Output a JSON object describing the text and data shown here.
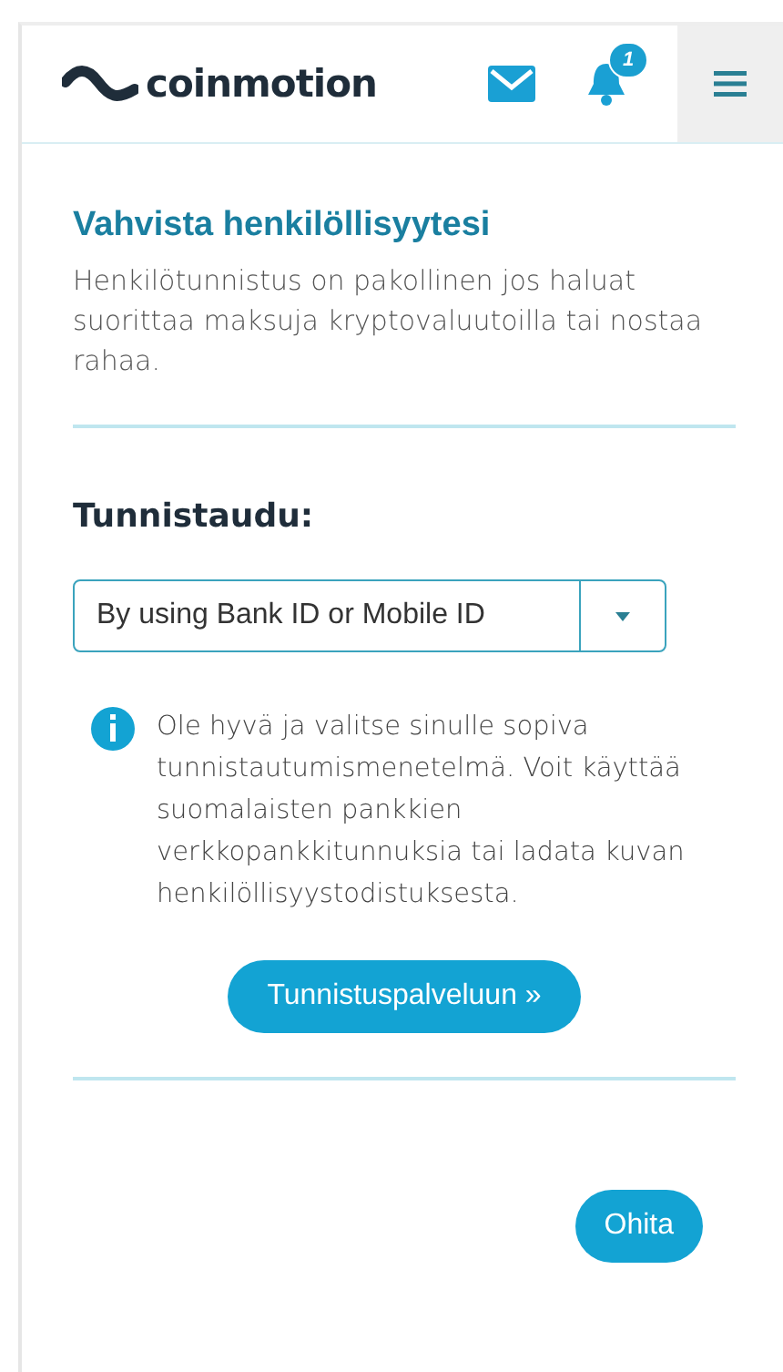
{
  "header": {
    "logo": "coinmotion",
    "notification_count": "1"
  },
  "verify": {
    "title": "Vahvista henkilöllisyytesi",
    "text": "Henkilötunnistus on pakollinen jos haluat suorittaa maksuja kryptovaluutoilla tai nostaa rahaa."
  },
  "method": {
    "label": "Tunnistaudu:",
    "value": "By using Bank ID or Mobile ID"
  },
  "info": "Ole hyvä ja valitse sinulle sopiva tunnistautumismenetelmä. Voit käyttää suomalaisten pankkien verkkopankkitunnuksia tai ladata kuvan henkilöllisyystodistuksesta.",
  "buttons": [
    {
      "label": "Tunnistuspalveluun »",
      "kind": "primary"
    },
    {
      "label": "Ohita",
      "kind": "skip"
    }
  ]
}
